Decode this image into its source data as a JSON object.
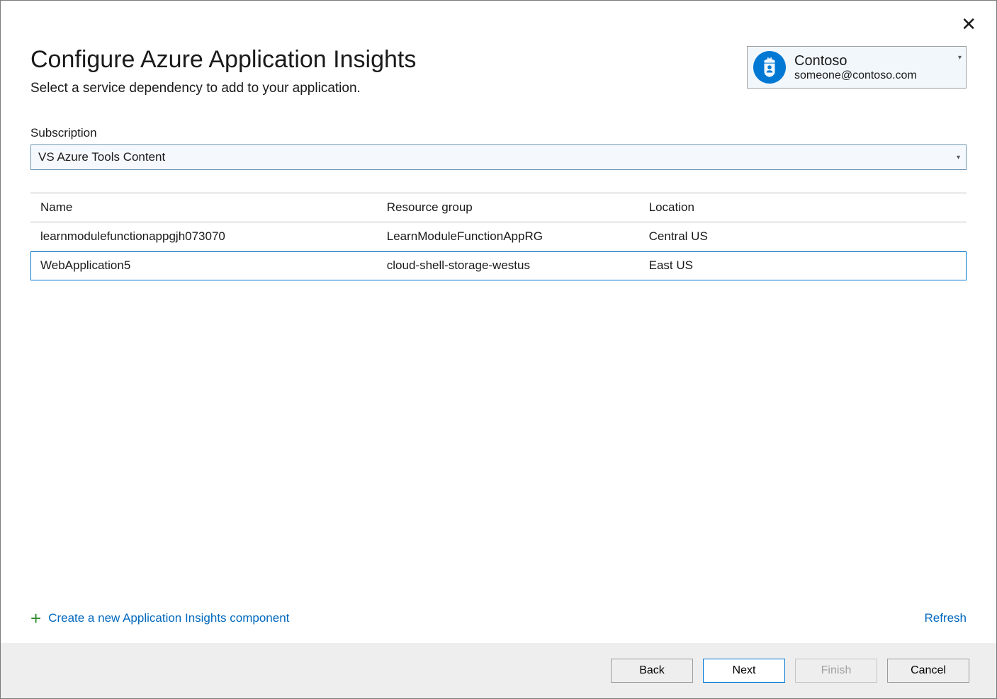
{
  "header": {
    "title": "Configure Azure Application Insights",
    "subtitle": "Select a service dependency to add to your application."
  },
  "account": {
    "org": "Contoso",
    "email": "someone@contoso.com"
  },
  "subscription": {
    "label": "Subscription",
    "selected": "VS Azure Tools Content"
  },
  "table": {
    "columns": {
      "name": "Name",
      "resource_group": "Resource group",
      "location": "Location"
    },
    "rows": [
      {
        "name": "learnmodulefunctionappgjh073070",
        "resource_group": "LearnModuleFunctionAppRG",
        "location": "Central US",
        "selected": false
      },
      {
        "name": "WebApplication5",
        "resource_group": "cloud-shell-storage-westus",
        "location": "East US",
        "selected": true
      }
    ]
  },
  "links": {
    "create": "Create a new Application Insights component",
    "refresh": "Refresh"
  },
  "footer": {
    "back": "Back",
    "next": "Next",
    "finish": "Finish",
    "cancel": "Cancel"
  }
}
